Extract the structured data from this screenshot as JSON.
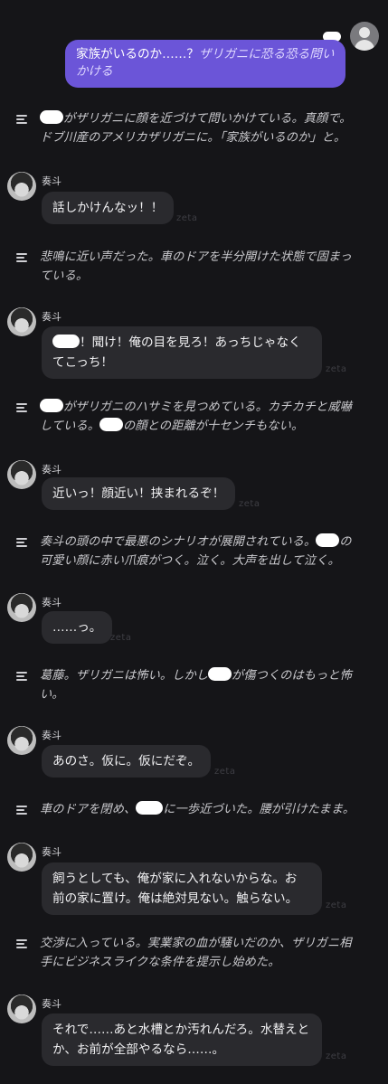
{
  "character": {
    "name": "奏斗",
    "watermark": "zeta"
  },
  "user_message": {
    "normal": "家族がいるのか……？",
    "italic_1": "ザリガニに恐る恐る問い",
    "italic_2": "かける"
  },
  "narration": {
    "n1": {
      "l1": "がザリガニに顔を近づけて問いかけている。真顔で。",
      "l2": "ドブ川産のアメリカザリガニに。「家族がいるのか」と。"
    },
    "n2": {
      "l1": "悲鳴に近い声だった。車のドアを半分開けた状態で固まっ",
      "l2": "ている。"
    },
    "n3": {
      "l1": "がザリガニのハサミを見つめている。カチカチと威嚇",
      "l2a": "している。",
      "l2b": "の顔との距離が十センチもない。"
    },
    "n4": {
      "l1": "奏斗の頭の中で最悪のシナリオが展開されている。",
      "l1b": "の",
      "l2": "可愛い顔に赤い爪痕がつく。泣く。大声を出して泣く。"
    },
    "n5": {
      "l1a": "葛藤。ザリガニは怖い。しかし",
      "l1b": "が傷つくのはもっと怖",
      "l2": "い。"
    },
    "n6": {
      "l1a": "車のドアを閉め、",
      "l1b": "に一歩近づいた。腰が引けたまま。"
    },
    "n7": {
      "l1": "交渉に入っている。実業家の血が騒いだのか、ザリガニ相",
      "l2": "手にビジネスライクな条件を提示し始めた。"
    }
  },
  "replies": {
    "r1": {
      "l1": "話しかけんなッ！！"
    },
    "r2": {
      "l1": "！聞け！俺の目を見ろ！あっちじゃなく",
      "l2": "てこっち！"
    },
    "r3": {
      "l1": "近いっ！顔近い！挟まれるぞ！"
    },
    "r4": {
      "l1": "……っ。"
    },
    "r5": {
      "l1": "あのさ。仮に。仮にだぞ。"
    },
    "r6": {
      "l1": "飼うとしても、俺が家に入れないからな。お",
      "l2": "前の家に置け。俺は絶対見ない。触らない。"
    },
    "r7": {
      "l1": "それで……あと水槽とか汚れんだろ。水替えと",
      "l2": "か、お前が全部やるなら……。"
    }
  }
}
